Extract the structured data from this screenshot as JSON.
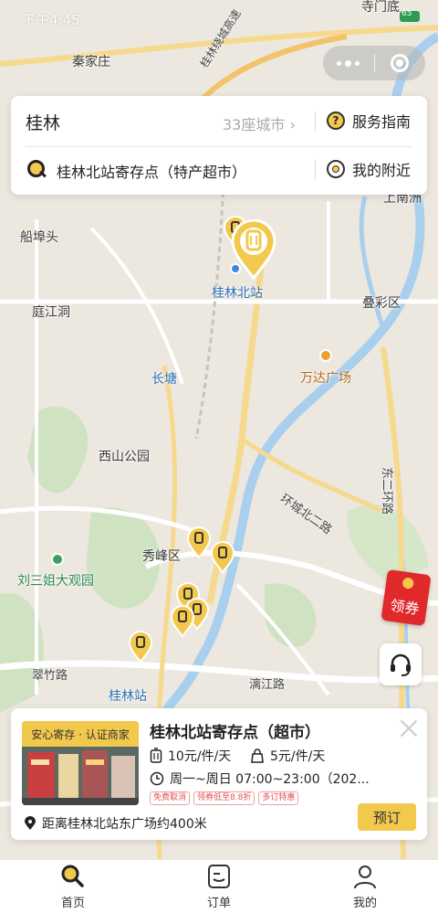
{
  "status_bar": {
    "time": "下午4:45"
  },
  "map": {
    "labels": {
      "qinjiazhuang": "秦家庄",
      "simendi": "寺门底",
      "ringway": "桂林绕城高速",
      "chuanbutou": "船埠头",
      "shangnanzhou": "上南洲",
      "tingjiangdong": "庭江洞",
      "north_station": "桂林北站",
      "diecai": "叠彩区",
      "changtang": "长塘",
      "wanda": "万达广场",
      "xishan": "西山公园",
      "huancheng": "环城北二路",
      "dongerhuan": "东二环路",
      "xiufeng": "秀峰区",
      "liusanjie": "刘三姐大观园",
      "cuizhu": "翠竹路",
      "guilin_station": "桂林站",
      "lijiang_rd": "漓江路",
      "badge_65": "65"
    }
  },
  "capsule": {
    "more_icon": "more-dots-icon",
    "close_icon": "record-icon"
  },
  "search": {
    "city": "桂林",
    "city_count": "33座城市 ›",
    "guide_label": "服务指南",
    "keyword": "桂林北站寄存点（特产超市）",
    "nearby_label": "我的附近"
  },
  "floating": {
    "coupon_label": "领券",
    "service_icon": "headset-icon"
  },
  "store": {
    "tag": "安心寄存 · 认证商家",
    "name": "桂林北站寄存点（超市）",
    "price_large": "10元/件/天",
    "price_small": "5元/件/天",
    "hours": "周一~周日 07:00~23:00（202...",
    "tags": [
      "免费取消",
      "领券低至8.8折",
      "多订特惠"
    ],
    "book_label": "预订",
    "distance": "距离桂林北站东广场约400米"
  },
  "tabs": [
    {
      "label": "首页",
      "icon": "search-icon"
    },
    {
      "label": "订单",
      "icon": "order-icon"
    },
    {
      "label": "我的",
      "icon": "user-icon"
    }
  ],
  "colors": {
    "accent": "#f2c94c",
    "coupon": "#e0292a"
  }
}
